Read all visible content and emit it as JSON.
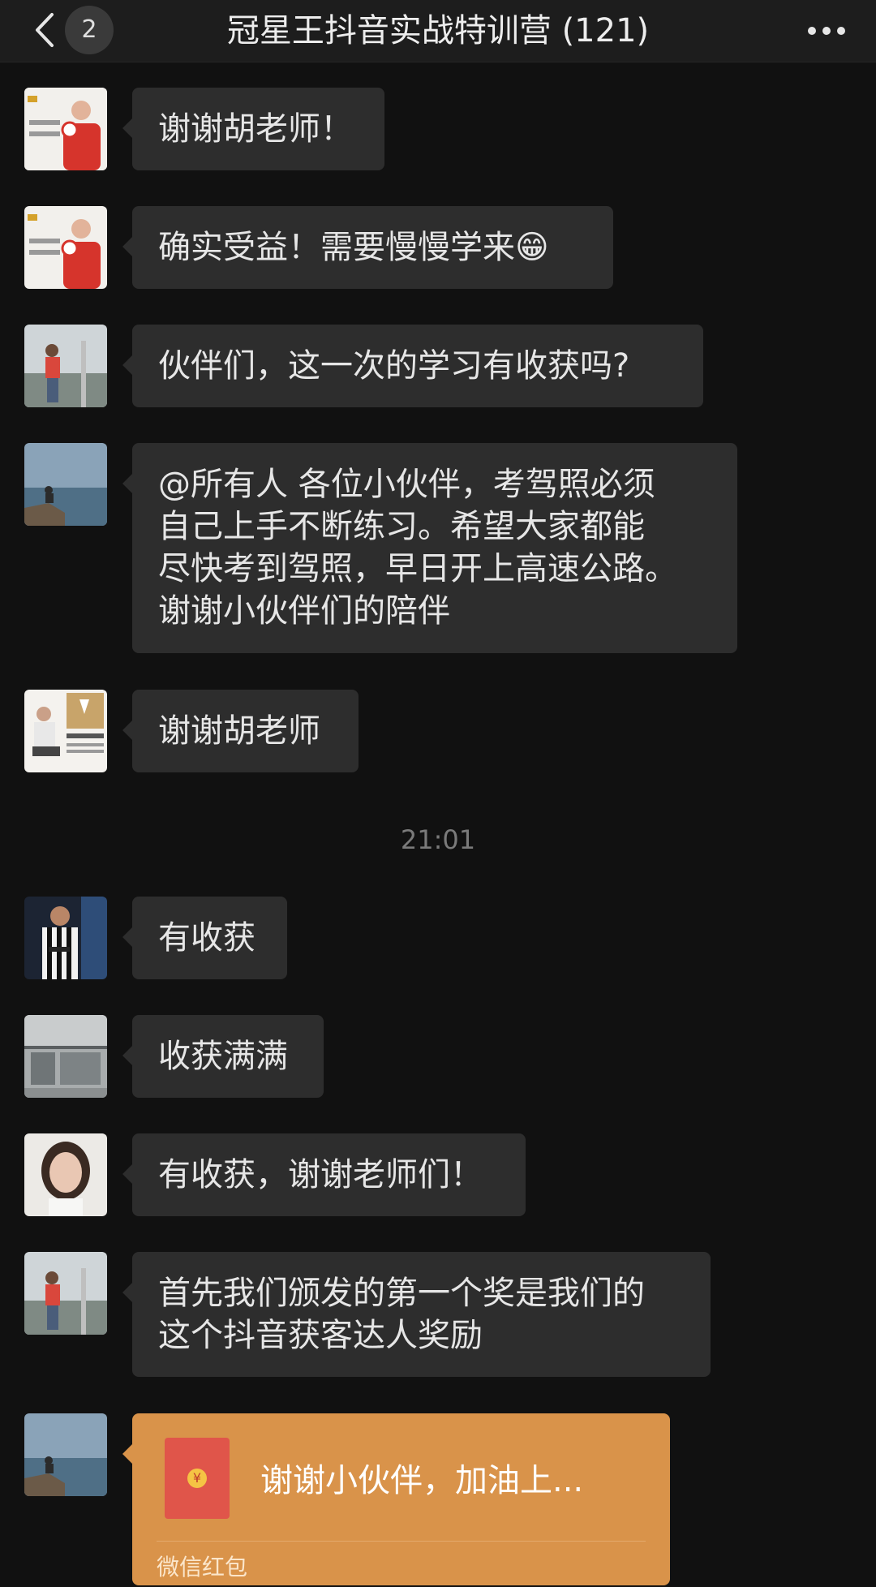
{
  "header": {
    "unread_count": "2",
    "title": "冠星王抖音实战特训营 (121)"
  },
  "messages": [
    {
      "text": "谢谢胡老师！"
    },
    {
      "text": "确实受益！需要慢慢学来😁"
    },
    {
      "text": "伙伴们，这一次的学习有收获吗?"
    },
    {
      "text": "@所有人 各位小伙伴，考驾照必须\n自己上手不断练习。希望大家都能\n尽快考到驾照，早日开上高速公路。\n谢谢小伙伴们的陪伴"
    },
    {
      "text": "谢谢胡老师"
    },
    {
      "text": "有收获"
    },
    {
      "text": "收获满满"
    },
    {
      "text": "有收获，谢谢老师们！"
    },
    {
      "text": "首先我们颁发的第一个奖是我们的\n这个抖音获客达人奖励"
    }
  ],
  "timestamp": "21:01",
  "red_packet": {
    "text": "谢谢小伙伴，加油上...",
    "label": "微信红包",
    "coin": "¥"
  },
  "colors": {
    "background": "#111111",
    "bubble": "#2d2d2d",
    "red_packet": "#d9934a"
  }
}
